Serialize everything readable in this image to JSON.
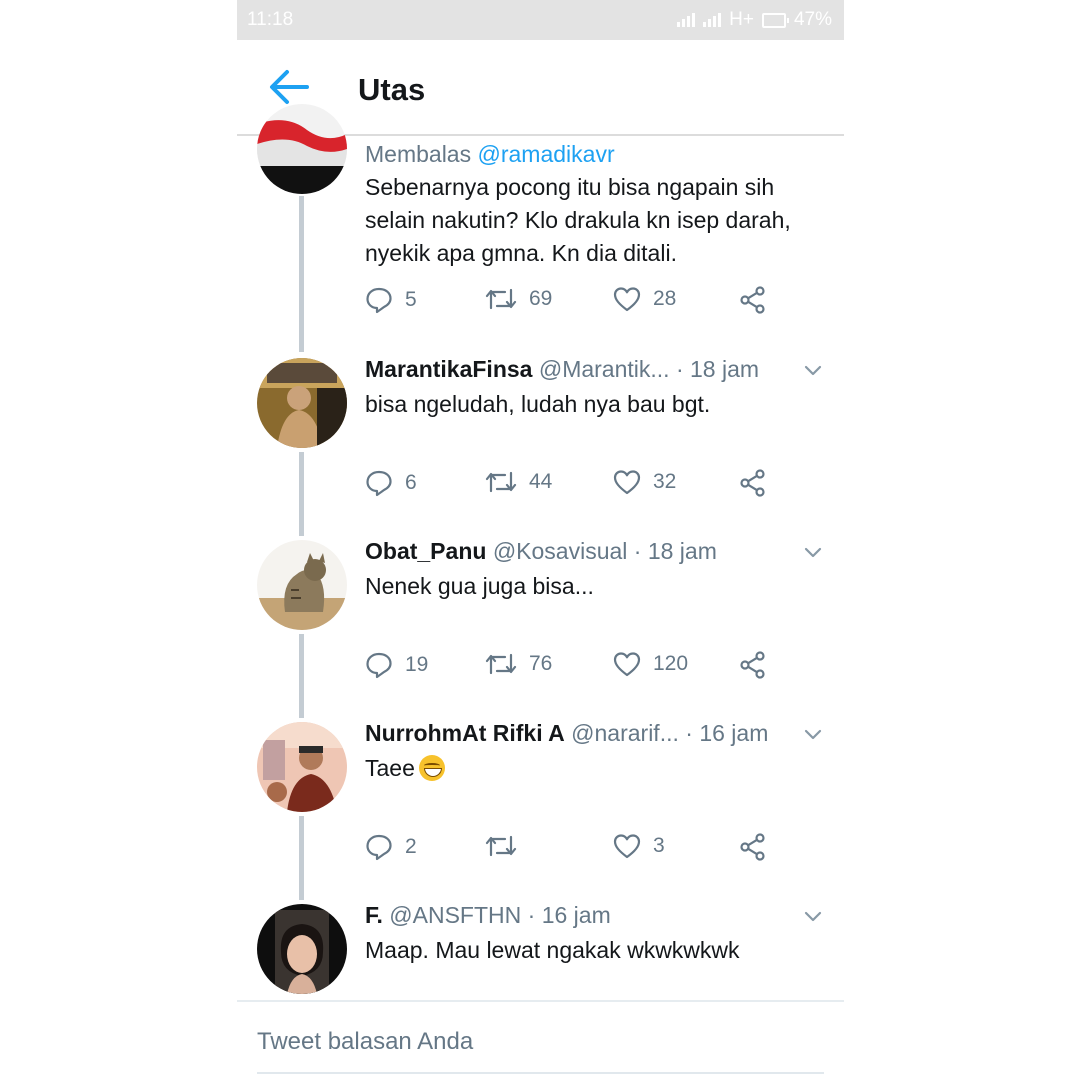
{
  "status_bar": {
    "time": "11:18",
    "network": "H+",
    "battery": "47%"
  },
  "app_bar": {
    "title": "Utas"
  },
  "tweets": [
    {
      "replying_prefix": "Membalas",
      "replying_to": "@ramadikavr",
      "text": "Sebenarnya pocong itu bisa ngapain sih selain nakutin? Klo drakula kn isep darah, nyekik apa gmna. Kn dia ditali.",
      "replies": "5",
      "retweets": "69",
      "likes": "28"
    },
    {
      "name": "MarantikaFinsa",
      "handle": "@Marantik...",
      "time": "· 18 jam",
      "text": "bisa ngeludah, ludah nya bau bgt.",
      "replies": "6",
      "retweets": "44",
      "likes": "32"
    },
    {
      "name": "Obat_Panu",
      "handle": "@Kosavisual",
      "time": "· 18 jam",
      "text": "Nenek gua juga bisa...",
      "replies": "19",
      "retweets": "76",
      "likes": "120"
    },
    {
      "name": "NurrohmAt Rifki A",
      "handle": "@nararif...",
      "time": "· 16 jam",
      "text": "Taee",
      "replies": "2",
      "retweets": "",
      "likes": "3"
    },
    {
      "name": "F.",
      "handle": "@ANSFTHN",
      "time": "· 16 jam",
      "text": "Maap. Mau lewat ngakak wkwkwkwk"
    }
  ],
  "reply_bar": {
    "placeholder": "Tweet balasan Anda"
  },
  "colors": {
    "link": "#1da1f2",
    "secondary": "#657786",
    "text": "#14171a",
    "thread_line": "#c4ccd3"
  }
}
